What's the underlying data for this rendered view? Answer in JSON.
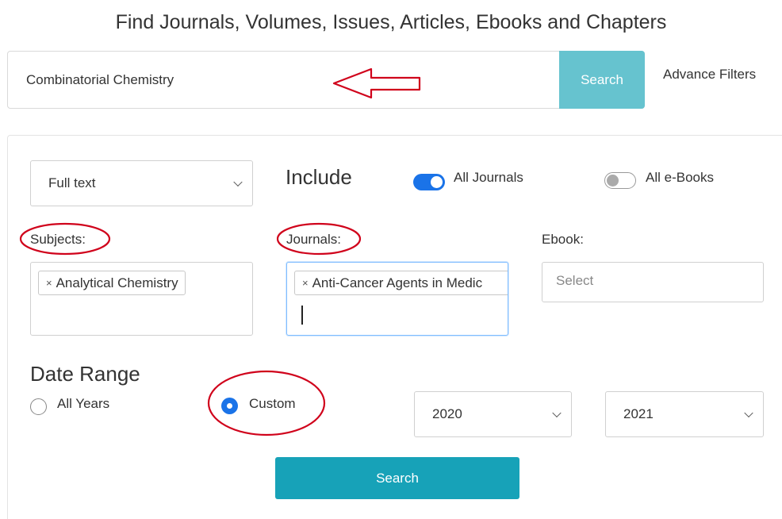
{
  "page": {
    "title": "Find Journals, Volumes, Issues, Articles, Ebooks and Chapters"
  },
  "search": {
    "value": "Combinatorial Chemistry",
    "button_label": "Search",
    "advance_filters_label": "Advance Filters"
  },
  "filters": {
    "search_scope": {
      "selected": "Full text"
    },
    "include_label": "Include",
    "toggles": [
      {
        "label": "All Journals",
        "on": true
      },
      {
        "label": "All e-Books",
        "on": false
      }
    ],
    "subjects": {
      "label": "Subjects:",
      "tags": [
        "Analytical Chemistry"
      ]
    },
    "journals": {
      "label": "Journals:",
      "tags": [
        "Anti-Cancer Agents in Medic"
      ]
    },
    "ebook": {
      "label": "Ebook:",
      "placeholder": "Select"
    },
    "date_range": {
      "label": "Date Range",
      "options": [
        {
          "label": "All Years",
          "selected": false
        },
        {
          "label": "Custom",
          "selected": true
        }
      ],
      "from_year": "2020",
      "to_year": "2021"
    },
    "submit_label": "Search"
  },
  "colors": {
    "search_button": "#66c3cf",
    "submit_button": "#17a2b8",
    "toggle_on": "#1a73e8",
    "annotation": "#d0021b"
  }
}
